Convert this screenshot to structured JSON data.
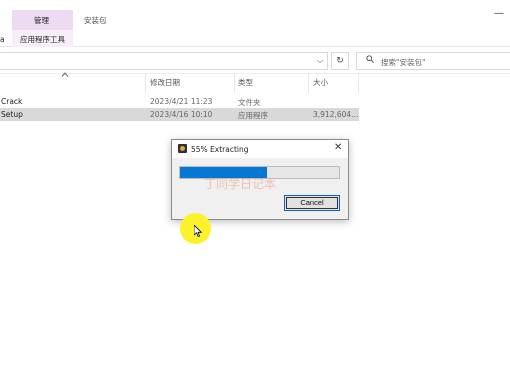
{
  "titlebar": {
    "context_tab": "管理",
    "folder_name": "安装包",
    "minimize": "—"
  },
  "ribbon": {
    "left_tab_fragment": "a",
    "context_tab_label": "应用程序工具"
  },
  "address": {
    "dropdown": "⌵",
    "refresh": "↻",
    "search_placeholder": "搜索\"安装包\""
  },
  "columns": {
    "name": "",
    "date": "修改日期",
    "type": "类型",
    "size": "大小"
  },
  "files": [
    {
      "name": "Crack",
      "date": "2023/4/21 11:23",
      "type": "文件夹",
      "size": ""
    },
    {
      "name": "Setup",
      "date": "2023/4/16 10:10",
      "type": "应用程序",
      "size": "3,912,604..."
    }
  ],
  "dialog": {
    "title": "55% Extracting",
    "progress_percent": 55,
    "watermark": "丁同学日记本",
    "cancel_label": "Cancel",
    "close": "✕"
  },
  "colors": {
    "accent": "#0678d4",
    "context_tab": "#eddaf3",
    "selection": "#d9d9d9",
    "cursor_highlight": "#fbf22b"
  }
}
